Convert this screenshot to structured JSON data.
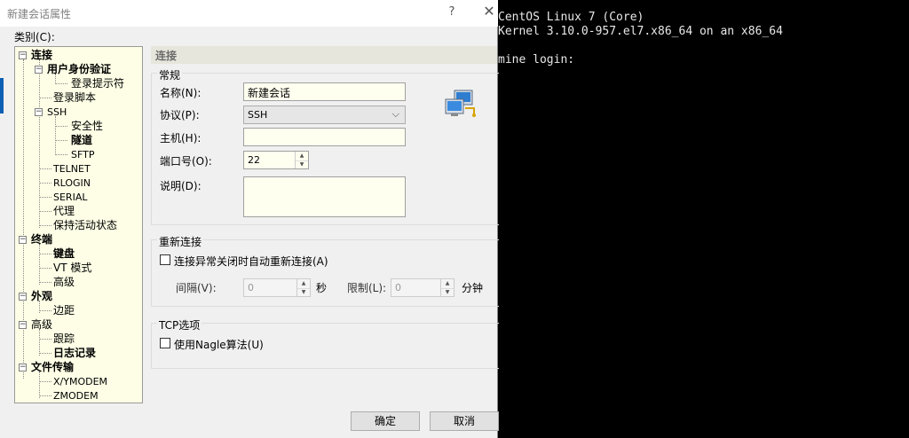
{
  "window": {
    "title": "新建会话属性",
    "help": "?",
    "close": "✕"
  },
  "category_label": "类别(C):",
  "tree": [
    {
      "label": "连接",
      "bold": true,
      "expander": "⊟"
    },
    {
      "label": "用户身份验证",
      "bold": true,
      "expander": "⊟"
    },
    {
      "label": "登录提示符",
      "bold": false
    },
    {
      "label": "登录脚本",
      "bold": false
    },
    {
      "label": "SSH",
      "bold": false,
      "expander": "⊟"
    },
    {
      "label": "安全性",
      "bold": false
    },
    {
      "label": "隧道",
      "bold": true
    },
    {
      "label": "SFTP",
      "bold": false
    },
    {
      "label": "TELNET",
      "bold": false
    },
    {
      "label": "RLOGIN",
      "bold": false
    },
    {
      "label": "SERIAL",
      "bold": false
    },
    {
      "label": "代理",
      "bold": false
    },
    {
      "label": "保持活动状态",
      "bold": false
    },
    {
      "label": "终端",
      "bold": true,
      "expander": "⊟"
    },
    {
      "label": "键盘",
      "bold": true
    },
    {
      "label": "VT 模式",
      "bold": false
    },
    {
      "label": "高级",
      "bold": false
    },
    {
      "label": "外观",
      "bold": true,
      "expander": "⊟"
    },
    {
      "label": "边距",
      "bold": false
    },
    {
      "label": "高级",
      "bold": false,
      "expander": "⊟"
    },
    {
      "label": "跟踪",
      "bold": false
    },
    {
      "label": "日志记录",
      "bold": true
    },
    {
      "label": "文件传输",
      "bold": true,
      "expander": "⊟"
    },
    {
      "label": "X/YMODEM",
      "bold": false
    },
    {
      "label": "ZMODEM",
      "bold": false
    }
  ],
  "panel": {
    "header": "连接",
    "general": {
      "title": "常规",
      "name_label": "名称(N):",
      "name_value": "新建会话",
      "protocol_label": "协议(P):",
      "protocol_value": "SSH",
      "host_label": "主机(H):",
      "host_value": "",
      "port_label": "端口号(O):",
      "port_value": "22",
      "desc_label": "说明(D):",
      "desc_value": ""
    },
    "reconnect": {
      "title": "重新连接",
      "checkbox_label": "连接异常关闭时自动重新连接(A)",
      "interval_label": "间隔(V):",
      "interval_value": "0",
      "interval_unit": "秒",
      "limit_label": "限制(L):",
      "limit_value": "0",
      "limit_unit": "分钟"
    },
    "tcp": {
      "title": "TCP选项",
      "nagle_label": "使用Nagle算法(U)"
    }
  },
  "buttons": {
    "ok": "确定",
    "cancel": "取消"
  },
  "terminal": {
    "lines": [
      "CentOS Linux 7 (Core)",
      "Kernel 3.10.0-957.el7.x86_64 on an x86_64",
      "",
      "mine login:"
    ]
  },
  "colors": {
    "tree_bg": "#fefee6",
    "terminal_bg": "#000000",
    "terminal_fg": "#e8e8e8"
  }
}
